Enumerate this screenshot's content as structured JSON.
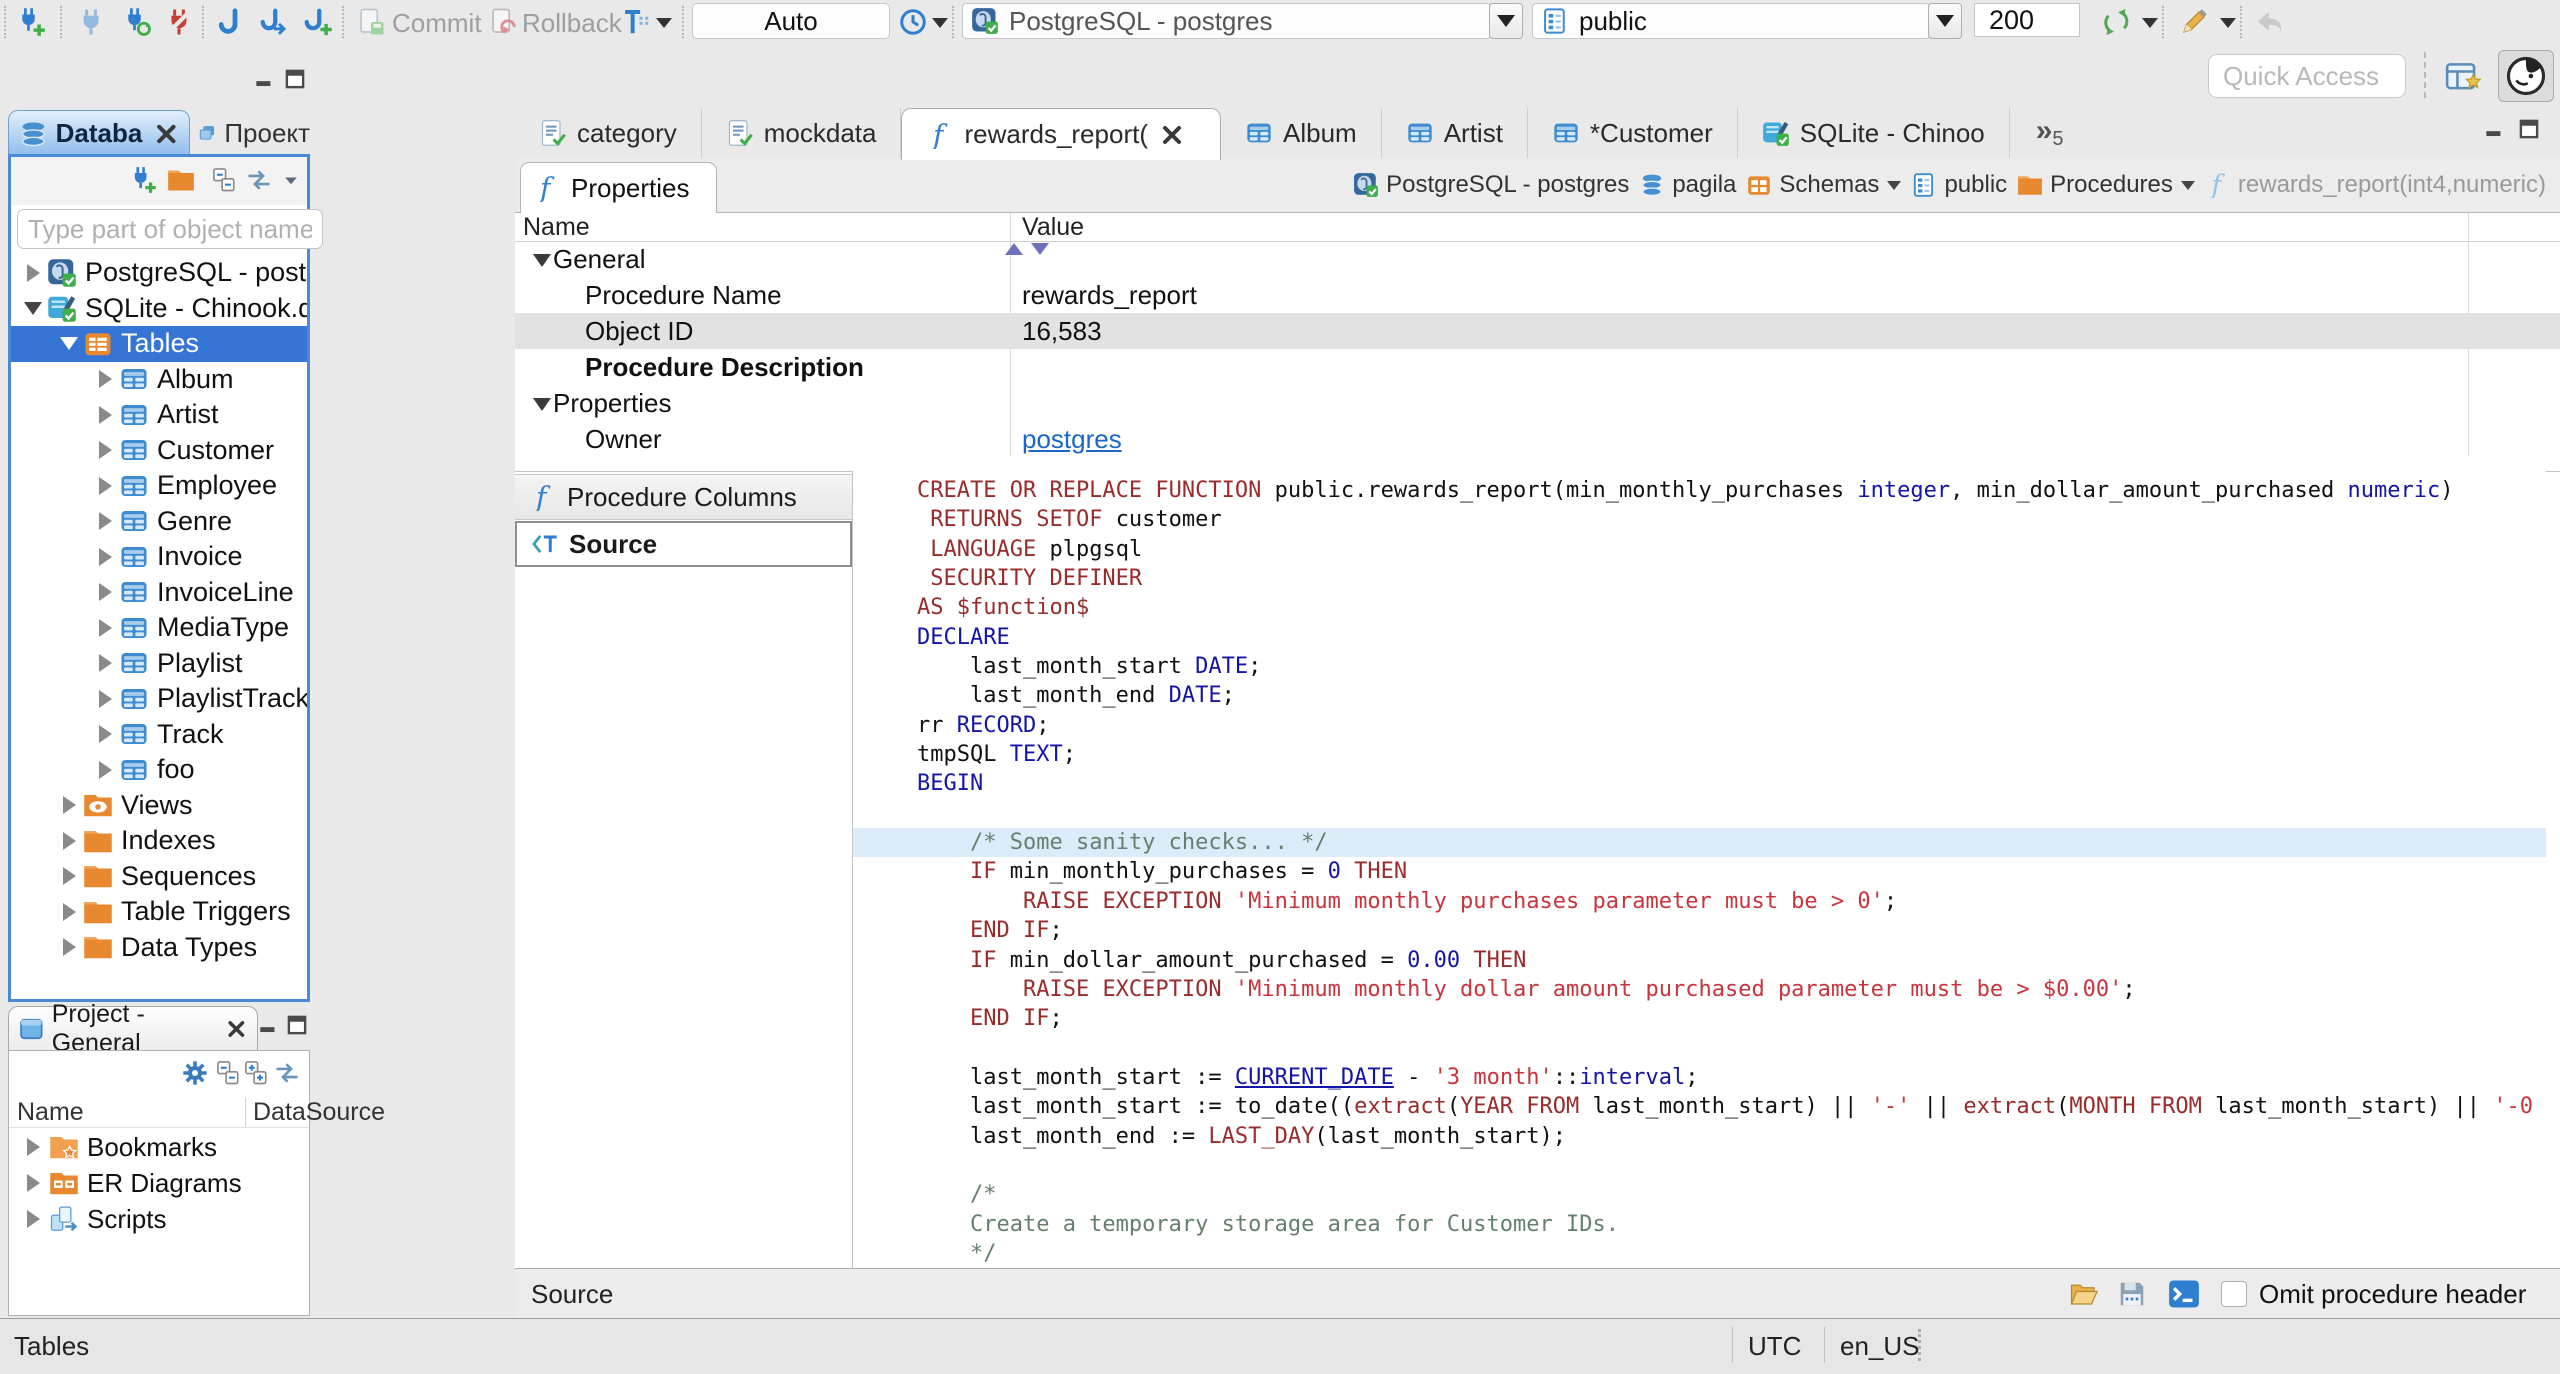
{
  "colors": {
    "accent": "#4a8ad4",
    "tree_selection": "#3575d5",
    "active_tab_gradient": "#8fbcec",
    "code_keyword": "#992b2b",
    "code_type": "#1414a8",
    "code_string": "#c9343c",
    "code_comment": "#65806d",
    "value_link": "#1a66c9",
    "current_line_highlight": "#dcebfa"
  },
  "toolbar": {
    "commit_label": "Commit",
    "rollback_label": "Rollback",
    "auto_commit": "Auto",
    "connection": "PostgreSQL - postgres",
    "schema": "public",
    "fetch_size": "200",
    "quick_access_placeholder": "Quick Access",
    "icons": [
      "new-connection",
      "connect",
      "reconnect",
      "disconnect",
      "sql-editor",
      "new-sql-editor",
      "recent-sql-editor",
      "commit",
      "rollback",
      "transaction-mode",
      "history-clock",
      "refresh",
      "generate-sql",
      "back",
      "perspective",
      "dbeaver-logo"
    ]
  },
  "sidebar": {
    "tabs": [
      {
        "label": "Databa"
      },
      {
        "label": "Проект"
      }
    ],
    "filter_placeholder": "Type part of object name to filter",
    "toolbar_icons": [
      "new-connection",
      "connection-folder",
      "collapse-all",
      "link-with-editor",
      "view-menu"
    ],
    "tree": [
      {
        "d": 0,
        "a": "c",
        "icon": "postgres",
        "label": "PostgreSQL - postgres"
      },
      {
        "d": 0,
        "a": "e",
        "icon": "sqlite",
        "label": "SQLite - Chinook.db"
      },
      {
        "d": 1,
        "a": "e",
        "icon": "tables-folder",
        "label": "Tables",
        "sel": true
      },
      {
        "d": 2,
        "a": "c",
        "icon": "table",
        "label": "Album"
      },
      {
        "d": 2,
        "a": "c",
        "icon": "table",
        "label": "Artist"
      },
      {
        "d": 2,
        "a": "c",
        "icon": "table",
        "label": "Customer"
      },
      {
        "d": 2,
        "a": "c",
        "icon": "table",
        "label": "Employee"
      },
      {
        "d": 2,
        "a": "c",
        "icon": "table",
        "label": "Genre"
      },
      {
        "d": 2,
        "a": "c",
        "icon": "table",
        "label": "Invoice"
      },
      {
        "d": 2,
        "a": "c",
        "icon": "table",
        "label": "InvoiceLine"
      },
      {
        "d": 2,
        "a": "c",
        "icon": "table",
        "label": "MediaType"
      },
      {
        "d": 2,
        "a": "c",
        "icon": "table",
        "label": "Playlist"
      },
      {
        "d": 2,
        "a": "c",
        "icon": "table",
        "label": "PlaylistTrack"
      },
      {
        "d": 2,
        "a": "c",
        "icon": "table",
        "label": "Track"
      },
      {
        "d": 2,
        "a": "c",
        "icon": "table",
        "label": "foo"
      },
      {
        "d": 1,
        "a": "c",
        "icon": "views-folder",
        "label": "Views"
      },
      {
        "d": 1,
        "a": "c",
        "icon": "folder",
        "label": "Indexes"
      },
      {
        "d": 1,
        "a": "c",
        "icon": "folder",
        "label": "Sequences"
      },
      {
        "d": 1,
        "a": "c",
        "icon": "folder",
        "label": "Table Triggers"
      },
      {
        "d": 1,
        "a": "c",
        "icon": "folder",
        "label": "Data Types"
      }
    ]
  },
  "project_panel": {
    "title": "Project - General",
    "toolbar_icons": [
      "settings-gear",
      "collapse-all",
      "expand-all",
      "link-with-editor"
    ],
    "columns": [
      "Name",
      "DataSource"
    ],
    "items": [
      {
        "icon": "folder-star",
        "label": "Bookmarks"
      },
      {
        "icon": "folder-er",
        "label": "ER Diagrams"
      },
      {
        "icon": "scripts",
        "label": "Scripts"
      }
    ]
  },
  "editor": {
    "tabs": [
      {
        "icon": "script",
        "label": "category"
      },
      {
        "icon": "script",
        "label": "mockdata"
      },
      {
        "icon": "function",
        "label": "rewards_report(",
        "active": true,
        "close": true
      },
      {
        "icon": "table",
        "label": "Album"
      },
      {
        "icon": "table",
        "label": "Artist"
      },
      {
        "icon": "table",
        "label": "*Customer"
      },
      {
        "icon": "sqlite",
        "label": "SQLite - Chinoo"
      }
    ],
    "overflow_count": "5",
    "properties_tab_label": "Properties",
    "breadcrumb": [
      {
        "icon": "postgres",
        "label": "PostgreSQL - postgres"
      },
      {
        "icon": "database",
        "label": "pagila"
      },
      {
        "icon": "schemas",
        "label": "Schemas",
        "dd": true
      },
      {
        "icon": "schema",
        "label": "public"
      },
      {
        "icon": "folder",
        "label": "Procedures",
        "dd": true
      },
      {
        "icon": "function-light",
        "label": "rewards_report(int4,numeric)",
        "muted": true
      }
    ],
    "grid": {
      "columns": [
        "Name",
        "Value"
      ],
      "rows": [
        {
          "type": "group",
          "name": "General"
        },
        {
          "name": "Procedure Name",
          "value": "rewards_report"
        },
        {
          "name": "Object ID",
          "value": "16,583",
          "hl": true
        },
        {
          "name": "Procedure Description",
          "value": "",
          "bold": true
        },
        {
          "type": "group",
          "name": "Properties"
        },
        {
          "name": "Owner",
          "value": "postgres",
          "link": true
        }
      ]
    },
    "side_items": [
      {
        "icon": "function",
        "label": "Procedure Columns"
      },
      {
        "icon": "source",
        "label": "Source",
        "selected": true
      }
    ],
    "status_label": "Source",
    "status_icons": [
      "open-file",
      "save-to-file",
      "open-in-sql-console"
    ],
    "omit_label": "Omit procedure header"
  },
  "code": {
    "lines": [
      {
        "t": [
          [
            "k",
            "CREATE OR REPLACE FUNCTION "
          ],
          [
            "p",
            "public.rewards_report(min_monthly_purchases "
          ],
          [
            "b",
            "integer"
          ],
          [
            "p",
            ", min_dollar_amount_purchased "
          ],
          [
            "b",
            "numeric"
          ],
          [
            "p",
            ")"
          ]
        ]
      },
      {
        "t": [
          [
            "p",
            " "
          ],
          [
            "k",
            "RETURNS SETOF "
          ],
          [
            "p",
            "customer"
          ]
        ]
      },
      {
        "t": [
          [
            "p",
            " "
          ],
          [
            "k",
            "LANGUAGE "
          ],
          [
            "p",
            "plpgsql"
          ]
        ]
      },
      {
        "t": [
          [
            "p",
            " "
          ],
          [
            "k",
            "SECURITY DEFINER"
          ]
        ]
      },
      {
        "t": [
          [
            "k",
            "AS $function$"
          ]
        ]
      },
      {
        "t": [
          [
            "b",
            "DECLARE"
          ]
        ]
      },
      {
        "t": [
          [
            "p",
            "    last_month_start "
          ],
          [
            "b",
            "DATE"
          ],
          [
            "p",
            ";"
          ]
        ]
      },
      {
        "t": [
          [
            "p",
            "    last_month_end "
          ],
          [
            "b",
            "DATE"
          ],
          [
            "p",
            ";"
          ]
        ]
      },
      {
        "t": [
          [
            "p",
            "rr "
          ],
          [
            "b",
            "RECORD"
          ],
          [
            "p",
            ";"
          ]
        ]
      },
      {
        "t": [
          [
            "p",
            "tmpSQL "
          ],
          [
            "b",
            "TEXT"
          ],
          [
            "p",
            ";"
          ]
        ]
      },
      {
        "t": [
          [
            "b",
            "BEGIN"
          ]
        ]
      },
      {
        "t": []
      },
      {
        "hl": true,
        "t": [
          [
            "p",
            "    "
          ],
          [
            "c",
            "/* Some sanity checks... */"
          ]
        ]
      },
      {
        "t": [
          [
            "p",
            "    "
          ],
          [
            "k",
            "IF"
          ],
          [
            "p",
            " min_monthly_purchases = "
          ],
          [
            "n",
            "0"
          ],
          [
            "p",
            " "
          ],
          [
            "k",
            "THEN"
          ]
        ]
      },
      {
        "t": [
          [
            "p",
            "        "
          ],
          [
            "k",
            "RAISE EXCEPTION "
          ],
          [
            "s",
            "'Minimum monthly purchases parameter must be > 0'"
          ],
          [
            "p",
            ";"
          ]
        ]
      },
      {
        "t": [
          [
            "p",
            "    "
          ],
          [
            "k",
            "END IF"
          ],
          [
            "p",
            ";"
          ]
        ]
      },
      {
        "t": [
          [
            "p",
            "    "
          ],
          [
            "k",
            "IF"
          ],
          [
            "p",
            " min_dollar_amount_purchased = "
          ],
          [
            "n",
            "0.00"
          ],
          [
            "p",
            " "
          ],
          [
            "k",
            "THEN"
          ]
        ]
      },
      {
        "t": [
          [
            "p",
            "        "
          ],
          [
            "k",
            "RAISE EXCEPTION "
          ],
          [
            "s",
            "'Minimum monthly dollar amount purchased parameter must be > $0.00'"
          ],
          [
            "p",
            ";"
          ]
        ]
      },
      {
        "t": [
          [
            "p",
            "    "
          ],
          [
            "k",
            "END IF"
          ],
          [
            "p",
            ";"
          ]
        ]
      },
      {
        "t": []
      },
      {
        "t": [
          [
            "p",
            "    last_month_start := "
          ],
          [
            "u",
            "CURRENT_DATE"
          ],
          [
            "p",
            " - "
          ],
          [
            "s",
            "'3 month'"
          ],
          [
            "p",
            "::"
          ],
          [
            "b",
            "interval"
          ],
          [
            "p",
            ";"
          ]
        ]
      },
      {
        "t": [
          [
            "p",
            "    last_month_start := to_date(("
          ],
          [
            "k",
            "extract"
          ],
          [
            "p",
            "("
          ],
          [
            "k",
            "YEAR FROM"
          ],
          [
            "p",
            " last_month_start) || "
          ],
          [
            "s",
            "'-'"
          ],
          [
            "p",
            " || "
          ],
          [
            "k",
            "extract"
          ],
          [
            "p",
            "("
          ],
          [
            "k",
            "MONTH FROM"
          ],
          [
            "p",
            " last_month_start) || "
          ],
          [
            "s",
            "'-0"
          ]
        ]
      },
      {
        "t": [
          [
            "p",
            "    last_month_end := "
          ],
          [
            "k",
            "LAST_DAY"
          ],
          [
            "p",
            "(last_month_start);"
          ]
        ]
      },
      {
        "t": []
      },
      {
        "t": [
          [
            "p",
            "    "
          ],
          [
            "c",
            "/*"
          ]
        ]
      },
      {
        "t": [
          [
            "c",
            "    Create a temporary storage area for Customer IDs."
          ]
        ]
      },
      {
        "t": [
          [
            "c",
            "    */"
          ]
        ]
      }
    ]
  },
  "statusbar": {
    "context": "Tables",
    "timezone": "UTC",
    "locale": "en_US"
  }
}
